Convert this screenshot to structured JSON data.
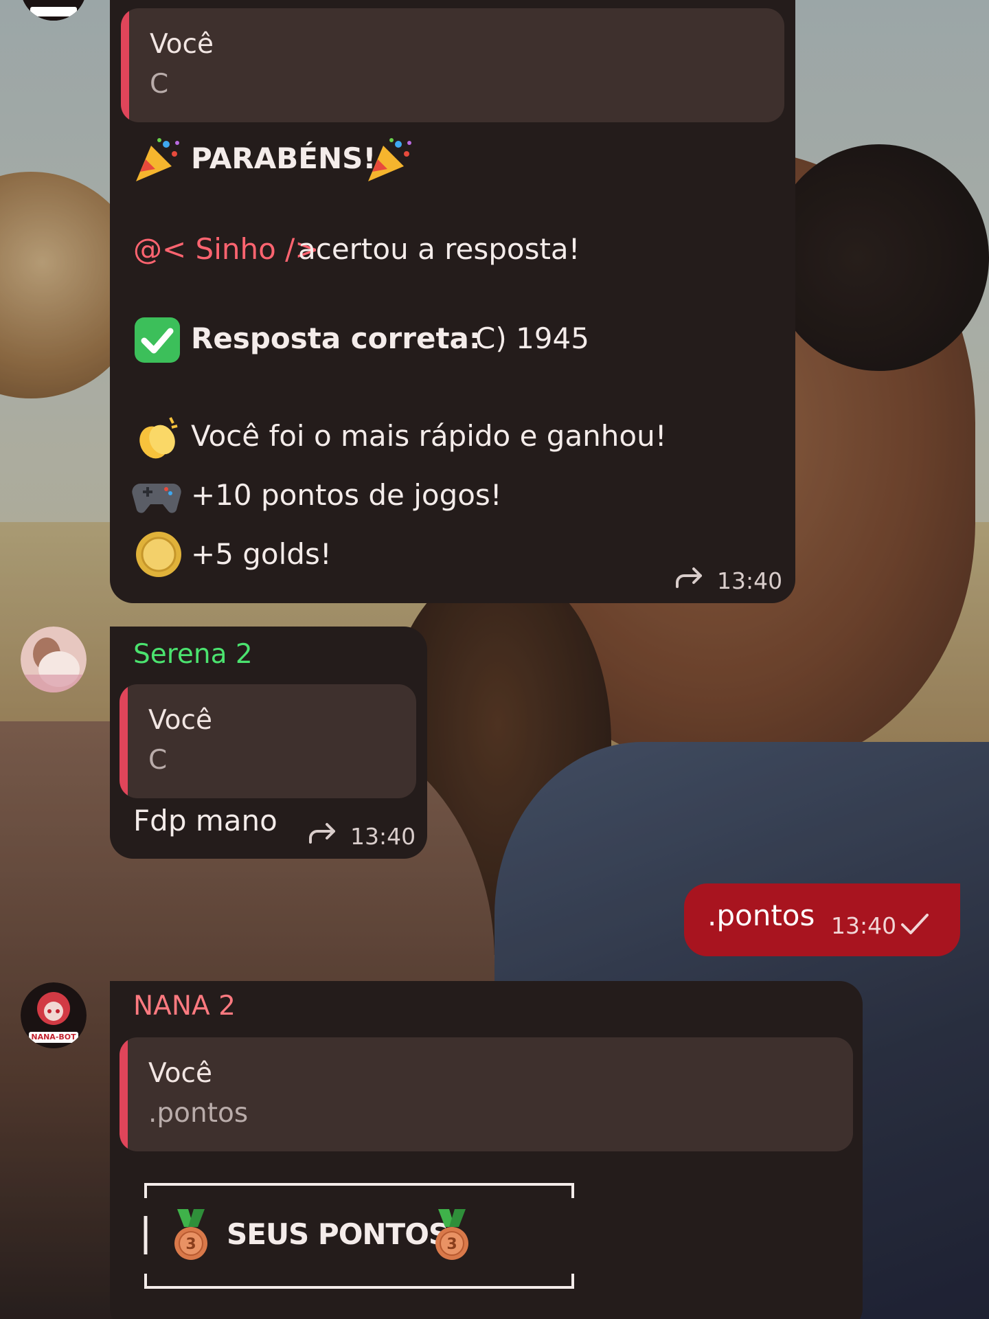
{
  "chat": {
    "messages": [
      {
        "quote": {
          "name": "Você",
          "text": "C"
        },
        "title": "PARABÉNS!",
        "mention": "@< Sinho />",
        "mention_rest": "acertou a resposta!",
        "answer_label": "Resposta correta:",
        "answer_value": "C) 1945",
        "fast_text": "Você foi o mais rápido e ganhou!",
        "points_text": "+10 pontos de jogos!",
        "gold_text": "+5 golds!",
        "time": "13:40"
      },
      {
        "sender": "Serena 2",
        "quote": {
          "name": "Você",
          "text": "C"
        },
        "text": "Fdp mano",
        "time": "13:40"
      },
      {
        "text": ".pontos",
        "time": "13:40"
      },
      {
        "sender": "NANA 2",
        "avatar_label": "NANA-BOT",
        "quote": {
          "name": "Você",
          "text": ".pontos"
        },
        "box_title": "SEUS PONTOS"
      }
    ]
  },
  "colors": {
    "incoming_bubble": "#241c1b",
    "quote_bg": "#3e302d",
    "quote_bar": "#e0455a",
    "outgoing_bubble": "#a8141f",
    "serena_name": "#4be36f",
    "nana_name": "#ff7a80",
    "mention": "#ff6470"
  },
  "icons": [
    "party-popper-icon",
    "check-mark-button-icon",
    "clapping-hands-icon",
    "game-controller-icon",
    "coin-icon",
    "bronze-medal-icon",
    "forward-icon",
    "sent-check-icon"
  ]
}
